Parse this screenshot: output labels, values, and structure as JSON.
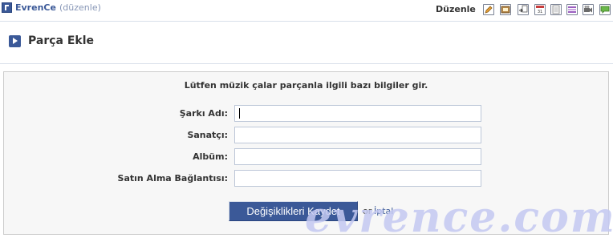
{
  "topbar": {
    "app_name": "EvrenCe",
    "edit_open": "(",
    "edit_link": "düzenle",
    "edit_close": ")",
    "toolbar_label": "Düzenle",
    "toolbar_icons": [
      {
        "name": "pencil-icon",
        "color": "#e8a13a"
      },
      {
        "name": "photo-icon",
        "color": "#b98a4a"
      },
      {
        "name": "move-icon",
        "color": "#9aa3b6"
      },
      {
        "name": "calendar-icon",
        "color": "#c73c3c"
      },
      {
        "name": "notes-icon",
        "color": "#f4f4f4"
      },
      {
        "name": "list-icon",
        "color": "#9b5fc0"
      },
      {
        "name": "video-icon",
        "color": "#6b6b6b"
      },
      {
        "name": "comment-icon",
        "color": "#6bb84a"
      }
    ]
  },
  "header": {
    "title": "Parça Ekle"
  },
  "form": {
    "intro": "Lütfen müzik çalar parçanla ilgili bazı bilgiler gir.",
    "fields": [
      {
        "label": "Şarkı Adı:",
        "value": ""
      },
      {
        "label": "Sanatçı:",
        "value": ""
      },
      {
        "label": "Albüm:",
        "value": ""
      },
      {
        "label": "Satın Alma Bağlantısı:",
        "value": ""
      }
    ],
    "save_label": "Değişiklikleri Kaydet",
    "or_text": "or",
    "cancel_label": "İptal"
  },
  "watermark": "evrence.com",
  "colors": {
    "brand": "#3b5998",
    "border": "#d8dfea",
    "panel_bg": "#f7f7f7",
    "input_border": "#bdc7d8",
    "watermark": "#c4c9f2"
  }
}
